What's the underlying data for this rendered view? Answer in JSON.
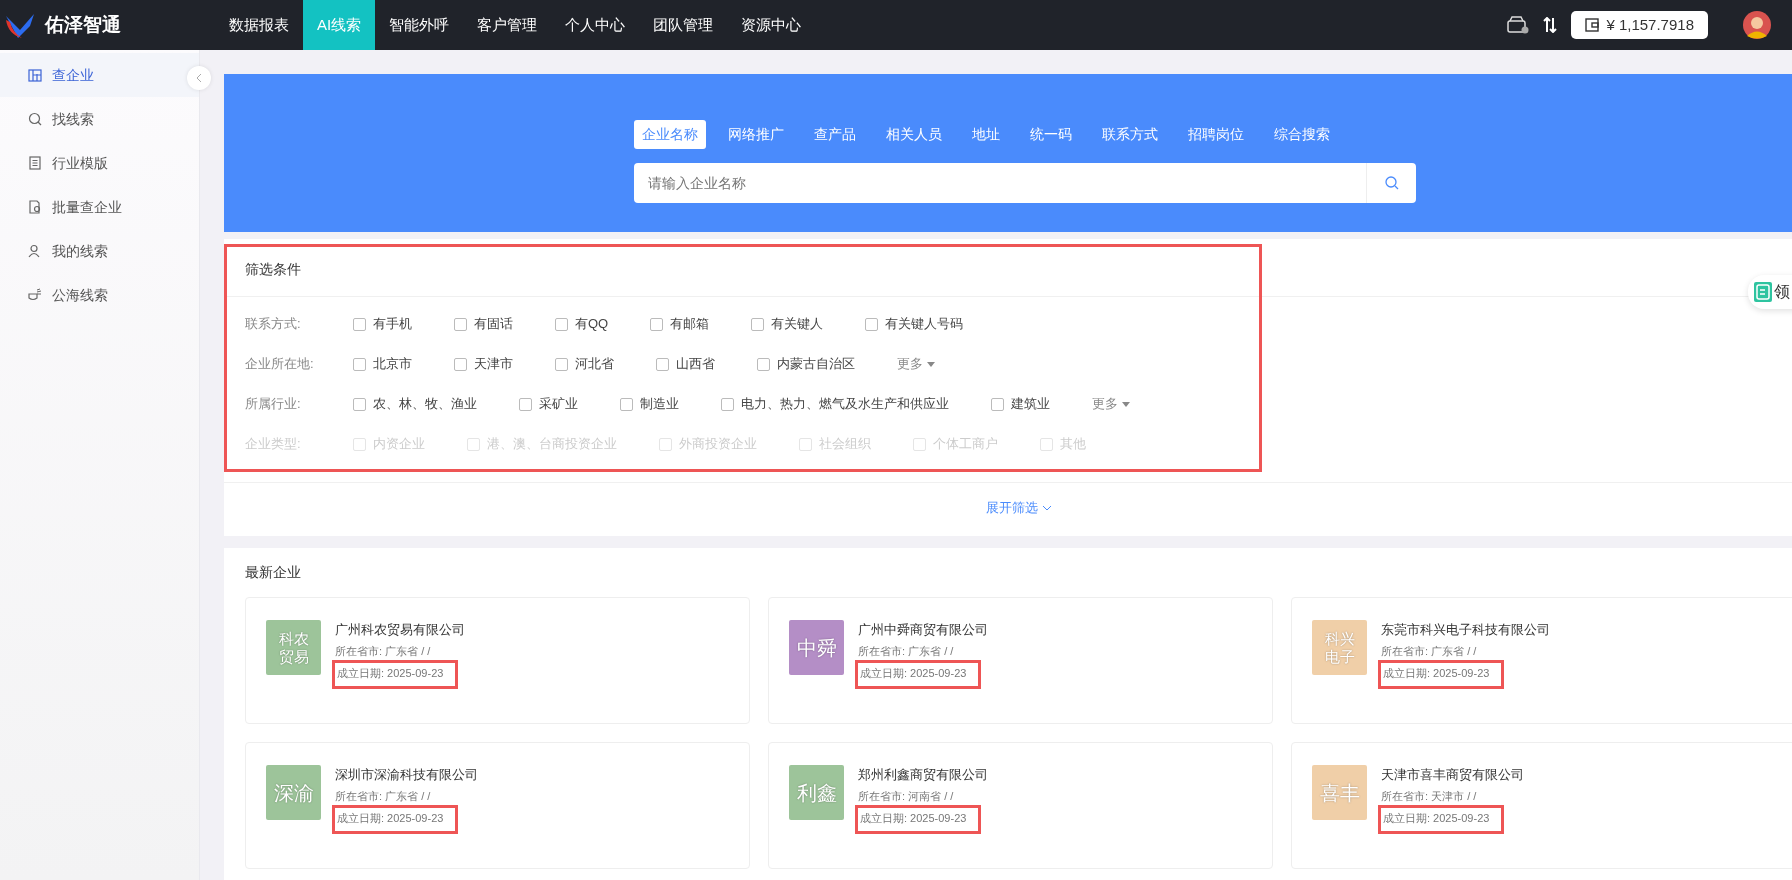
{
  "brand": {
    "name": "佑泽智通"
  },
  "nav": [
    {
      "label": "数据报表",
      "selected": false
    },
    {
      "label": "AI线索",
      "selected": true
    },
    {
      "label": "智能外呼",
      "selected": false
    },
    {
      "label": "客户管理",
      "selected": false
    },
    {
      "label": "个人中心",
      "selected": false
    },
    {
      "label": "团队管理",
      "selected": false
    },
    {
      "label": "资源中心",
      "selected": false
    }
  ],
  "header": {
    "balance": "¥ 1,157.7918"
  },
  "sidebar": {
    "items": [
      {
        "label": "查企业",
        "selected": true
      },
      {
        "label": "找线索",
        "selected": false
      },
      {
        "label": "行业模版",
        "selected": false
      },
      {
        "label": "批量查企业",
        "selected": false
      },
      {
        "label": "我的线索",
        "selected": false
      },
      {
        "label": "公海线索",
        "selected": false
      }
    ]
  },
  "search": {
    "tabs": [
      {
        "label": "企业名称",
        "selected": true
      },
      {
        "label": "网络推广",
        "selected": false
      },
      {
        "label": "查产品",
        "selected": false
      },
      {
        "label": "相关人员",
        "selected": false
      },
      {
        "label": "地址",
        "selected": false
      },
      {
        "label": "统一码",
        "selected": false
      },
      {
        "label": "联系方式",
        "selected": false
      },
      {
        "label": "招聘岗位",
        "selected": false
      },
      {
        "label": "综合搜索",
        "selected": false
      }
    ],
    "placeholder": "请输入企业名称"
  },
  "float_button": {
    "label": "领"
  },
  "filters": {
    "title": "筛选条件",
    "highlighted": true,
    "rows": [
      {
        "label": "联系方式:",
        "disabled": false,
        "options": [
          {
            "label": "有手机",
            "checked": false
          },
          {
            "label": "有固话",
            "checked": false
          },
          {
            "label": "有QQ",
            "checked": false
          },
          {
            "label": "有邮箱",
            "checked": false
          },
          {
            "label": "有关键人",
            "checked": false
          },
          {
            "label": "有关键人号码",
            "checked": false
          }
        ]
      },
      {
        "label": "企业所在地:",
        "disabled": false,
        "options": [
          {
            "label": "北京市",
            "checked": false
          },
          {
            "label": "天津市",
            "checked": false
          },
          {
            "label": "河北省",
            "checked": false
          },
          {
            "label": "山西省",
            "checked": false
          },
          {
            "label": "内蒙古自治区",
            "checked": false
          }
        ],
        "more": "更多"
      },
      {
        "label": "所属行业:",
        "disabled": false,
        "options": [
          {
            "label": "农、林、牧、渔业",
            "checked": false
          },
          {
            "label": "采矿业",
            "checked": false
          },
          {
            "label": "制造业",
            "checked": false
          },
          {
            "label": "电力、热力、燃气及水生产和供应业",
            "checked": false
          },
          {
            "label": "建筑业",
            "checked": false
          }
        ],
        "more": "更多"
      },
      {
        "label": "企业类型:",
        "disabled": true,
        "options": [
          {
            "label": "内资企业",
            "checked": false
          },
          {
            "label": "港、澳、台商投资企业",
            "checked": false
          },
          {
            "label": "外商投资企业",
            "checked": false
          },
          {
            "label": "社会组织",
            "checked": false
          },
          {
            "label": "个体工商户",
            "checked": false
          },
          {
            "label": "其他",
            "checked": false
          }
        ]
      }
    ],
    "expand": "展开筛选"
  },
  "latest": {
    "title": "最新企业",
    "companies": [
      {
        "logo": "科农贸易",
        "color": "#9dc49a",
        "name": "广州科农贸易有限公司",
        "region": "所在省市: 广东省 / /",
        "founded": "成立日期: 2025-09-23",
        "highlighted": true
      },
      {
        "logo": "中舜",
        "color": "#b48ec6",
        "name": "广州中舜商贸有限公司",
        "region": "所在省市: 广东省 / /",
        "founded": "成立日期: 2025-09-23",
        "highlighted": true
      },
      {
        "logo": "科兴电子",
        "color": "#f0cfa8",
        "name": "东莞市科兴电子科技有限公司",
        "region": "所在省市: 广东省 / /",
        "founded": "成立日期: 2025-09-23",
        "highlighted": true
      },
      {
        "logo": "深渝",
        "color": "#9dc49a",
        "name": "深圳市深渝科技有限公司",
        "region": "所在省市: 广东省 / /",
        "founded": "成立日期: 2025-09-23",
        "highlighted": true
      },
      {
        "logo": "利鑫",
        "color": "#9dc49a",
        "name": "郑州利鑫商贸有限公司",
        "region": "所在省市: 河南省 / /",
        "founded": "成立日期: 2025-09-23",
        "highlighted": true
      },
      {
        "logo": "喜丰",
        "color": "#f0cfa8",
        "name": "天津市喜丰商贸有限公司",
        "region": "所在省市: 天津市 / /",
        "founded": "成立日期: 2025-09-23",
        "highlighted": true
      }
    ]
  }
}
